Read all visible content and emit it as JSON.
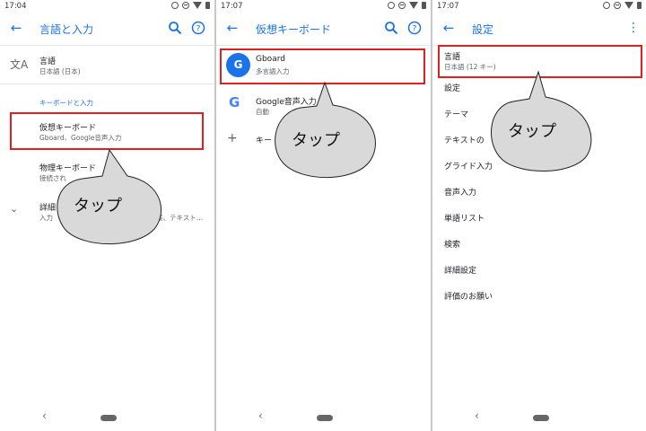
{
  "screens": [
    {
      "time": "17:04",
      "title": "言語と入力",
      "items": [
        {
          "title": "言語",
          "sub": "日本語 (日本)"
        },
        {
          "section": "キーボードと入力"
        },
        {
          "title": "仮想キーボード",
          "sub": "Gboard、Google音声入力"
        },
        {
          "title": "物理キーボード",
          "sub": "接続され"
        },
        {
          "title": "詳細",
          "sub": "入力",
          "sub_tail": "援、テキスト…"
        }
      ],
      "callout": "タップ"
    },
    {
      "time": "17:07",
      "title": "仮想キーボード",
      "items": [
        {
          "title": "Gboard",
          "sub": "多言語入力"
        },
        {
          "title": "Google音声入力",
          "sub": "自動"
        },
        {
          "title": "キー"
        }
      ],
      "callout": "タップ"
    },
    {
      "time": "17:07",
      "title": "設定",
      "items": [
        {
          "title": "言語",
          "sub": "日本語 (12 キー)"
        },
        {
          "title": "設定"
        },
        {
          "title": "テーマ"
        },
        {
          "title": "テキストの"
        },
        {
          "title": "グライド入力"
        },
        {
          "title": "音声入力"
        },
        {
          "title": "単語リスト"
        },
        {
          "title": "検索"
        },
        {
          "title": "詳細設定"
        },
        {
          "title": "評価のお願い"
        }
      ],
      "callout": "タップ"
    }
  ],
  "colors": {
    "accent": "#1a73e8",
    "highlight": "#e02020",
    "bubble": "#d9d9d9"
  },
  "icons": [
    "back-arrow-icon",
    "search-icon",
    "help-icon",
    "more-vert-icon",
    "translate-icon",
    "chevron-down-icon",
    "gboard-icon",
    "google-g-icon",
    "plus-icon"
  ]
}
